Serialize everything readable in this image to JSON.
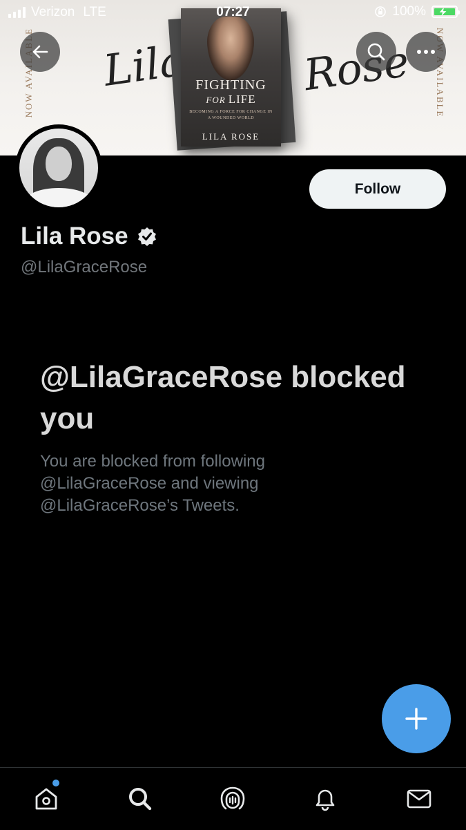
{
  "status_bar": {
    "carrier": "Verizon",
    "network": "LTE",
    "time": "07:27",
    "battery": "100%"
  },
  "banner": {
    "side_text": "NOW AVAILABLE",
    "script_left": "Lila",
    "script_right": "Rose",
    "book": {
      "title_line1": "FIGHTING",
      "title_for": "FOR",
      "title_life": "LIFE",
      "tagline": "BECOMING A FORCE FOR CHANGE IN A WOUNDED WORLD",
      "author": "LILA ROSE"
    }
  },
  "profile": {
    "name": "Lila Rose",
    "handle": "@LilaGraceRose",
    "follow_label": "Follow",
    "verified": true
  },
  "blocked": {
    "title": "@LilaGraceRose blocked you",
    "description": "You are blocked from following @LilaGraceRose and viewing @LilaGraceRose’s Tweets."
  },
  "colors": {
    "accent": "#4a9de8",
    "background": "#000000",
    "follow_bg": "#eff3f4",
    "battery": "#4cd964"
  },
  "icons": {
    "back": "arrow-left-icon",
    "search": "search-icon",
    "more": "more-icon",
    "compose": "plus-icon",
    "tabs": [
      "home-icon",
      "search-icon",
      "spaces-icon",
      "bell-icon",
      "mail-icon"
    ]
  }
}
